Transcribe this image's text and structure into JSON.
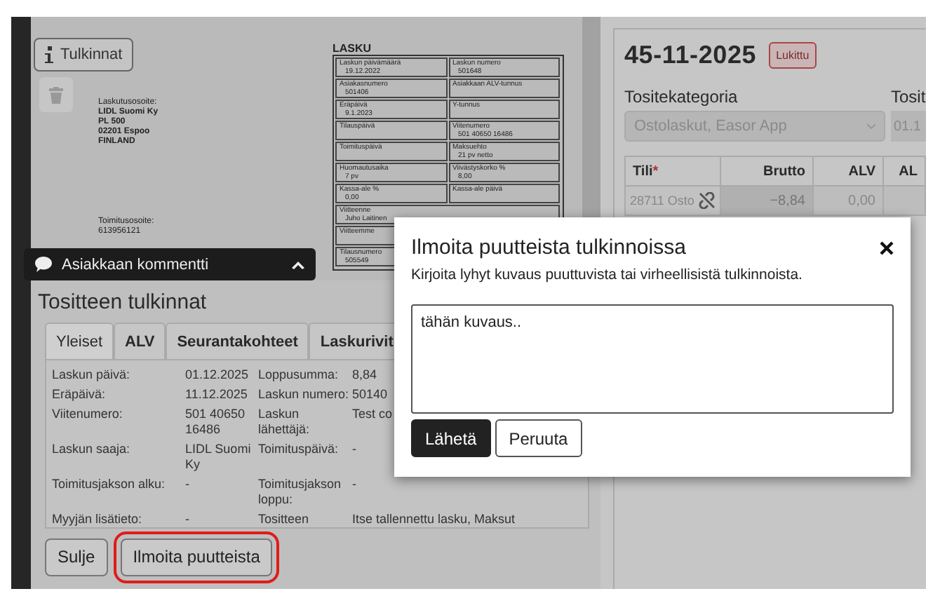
{
  "document_preview": {
    "heading": "LASKU",
    "billing_address": [
      "Laskutusosoite:",
      "LIDL Suomi Ky",
      "PL 500",
      "02201 Espoo",
      "FINLAND"
    ],
    "delivery_address": [
      "Toimitusosoite:",
      "613956121"
    ],
    "rows": [
      {
        "cells": [
          {
            "label": "Laskun päivämäärä",
            "value": "19.12.2022"
          },
          {
            "label": "Laskun numero",
            "value": "501648"
          }
        ]
      },
      {
        "cells": [
          {
            "label": "Asiakasnumero",
            "value": "501406"
          },
          {
            "label": "Asiakkaan ALV-tunnus"
          }
        ]
      },
      {
        "cells": [
          {
            "label": "Eräpäivä",
            "value": "9.1.2023"
          },
          {
            "label": "Y-tunnus"
          }
        ]
      },
      {
        "cells": [
          {
            "label": "Tilauspäivä"
          },
          {
            "label": "Viitenumero",
            "value": "501 40650 16486"
          }
        ]
      },
      {
        "cells": [
          {
            "label": "Toimituspäivä"
          },
          {
            "label": "Maksuehto",
            "value": "21 pv netto"
          }
        ]
      },
      {
        "cells": [
          {
            "label": "Huomautusaika",
            "value": "7 pv"
          },
          {
            "label": "Viivästyskorko %",
            "value": "8,00"
          }
        ]
      },
      {
        "cells": [
          {
            "label": "Kassa-ale %",
            "value": "0,00"
          },
          {
            "label": "Kassa-ale päivä"
          }
        ]
      },
      {
        "cells": [
          {
            "label": "Viitteenne",
            "value": "Juho Laitinen"
          }
        ]
      },
      {
        "cells": [
          {
            "label": "Viitteemme"
          }
        ]
      },
      {
        "cells": [
          {
            "label": "Tilausnumero",
            "value": "505549"
          }
        ]
      }
    ]
  },
  "toolbar": {
    "interpretations_button": "Tulkinnat"
  },
  "comment_bar": {
    "title": "Asiakkaan kommentti"
  },
  "interpretations": {
    "title": "Tositteen tulkinnat",
    "tabs": [
      {
        "label": "Yleiset",
        "selected": true
      },
      {
        "label": "ALV",
        "selected": false
      },
      {
        "label": "Seurantakohteet",
        "selected": false
      },
      {
        "label": "Laskurivit",
        "selected": false
      }
    ],
    "rows": [
      [
        {
          "label": "Laskun päivä:",
          "value": "01.12.2025"
        },
        {
          "label": "Loppusumma:",
          "value": "8,84"
        }
      ],
      [
        {
          "label": "Eräpäivä:",
          "value": "11.12.2025"
        },
        {
          "label": "Laskun numero:",
          "value": "50140"
        }
      ],
      [
        {
          "label": "Viitenumero:",
          "value": "501 40650 16486"
        },
        {
          "label": "Laskun lähettäjä:",
          "value": "Test co"
        }
      ],
      [
        {
          "label": "Laskun saaja:",
          "value": "LIDL Suomi Ky"
        },
        {
          "label": "Toimituspäivä:",
          "value": "-"
        }
      ],
      [
        {
          "label": "Toimitusjakson alku:",
          "value": "-"
        },
        {
          "label": "Toimitusjakson loppu:",
          "value": "-"
        }
      ],
      [
        {
          "label": "Myyjän lisätieto:",
          "value": "-"
        },
        {
          "label": "Tositteen",
          "value": "Itse tallennettu lasku, Maksut"
        }
      ]
    ],
    "buttons": [
      {
        "label": "Sulje",
        "highlighted": false
      },
      {
        "label": "Ilmoita puutteista",
        "highlighted": true
      }
    ]
  },
  "voucher": {
    "number": "45-11-2025",
    "badge": "Lukittu",
    "category_label": "Tositekategoria",
    "category_value": "Ostolaskut, Easor App",
    "date_label": "Tosit",
    "date_value": "01.1",
    "table": {
      "columns": [
        {
          "label": "Tili",
          "required_mark": "*"
        },
        {
          "label": "Brutto"
        },
        {
          "label": "ALV"
        },
        {
          "label": "AL"
        }
      ],
      "rows": [
        [
          "28711 Osto",
          "−8,84",
          "0,00",
          ""
        ]
      ]
    }
  },
  "dialog": {
    "title": "Ilmoita puutteista tulkinnoissa",
    "description": "Kirjoita lyhyt kuvaus puuttuvista tai virheellisistä tulkinnoista.",
    "value": "tähän kuvaus..",
    "buttons": [
      {
        "label": "Lähetä",
        "kind": "primary"
      },
      {
        "label": "Peruuta",
        "kind": "secondary"
      }
    ]
  }
}
